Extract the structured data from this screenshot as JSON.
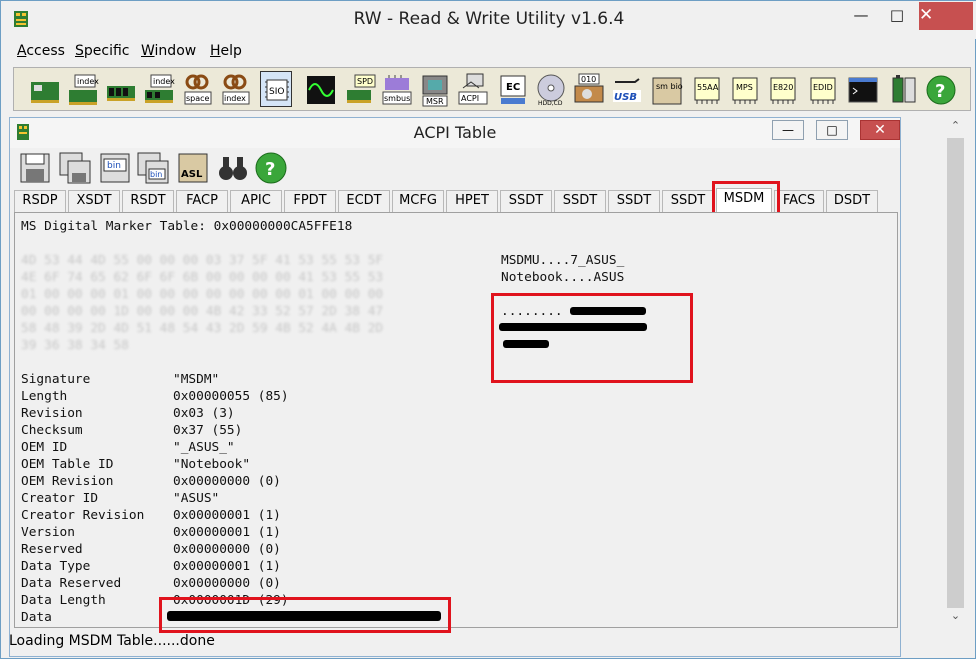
{
  "app": {
    "title": "RW - Read & Write Utility v1.6.4",
    "menu": [
      "Access",
      "Specific",
      "Window",
      "Help"
    ],
    "menu_underline": [
      "A",
      "S",
      "W",
      "H"
    ],
    "menu_rest": [
      "ccess",
      "pecific",
      "indow",
      "elp"
    ]
  },
  "toolbar": {
    "labels": [
      "index",
      "index",
      "space",
      "index",
      "SIO",
      "SPD",
      "smbus",
      "MSR",
      "ACPI",
      "EC",
      "HDD,CD",
      "010",
      "USB",
      "sm bios",
      "55AA",
      "MPS",
      "E820",
      "EDID"
    ]
  },
  "child": {
    "title": "ACPI Table",
    "toolbar_labels": [
      "bin",
      "bin",
      "ASL"
    ]
  },
  "tabs": [
    "RSDP",
    "XSDT",
    "RSDT",
    "FACP",
    "APIC",
    "FPDT",
    "ECDT",
    "MCFG",
    "HPET",
    "SSDT",
    "SSDT",
    "SSDT",
    "SSDT",
    "MSDM",
    "FACS",
    "DSDT"
  ],
  "selected_tab": "MSDM",
  "content": {
    "header": "MS Digital Marker Table: 0x00000000CA5FFE18",
    "ascii": [
      "MSDMU....7_ASUS_",
      "Notebook....ASUS",
      "........"
    ],
    "fields": [
      {
        "label": "Signature",
        "value": "\"MSDM\""
      },
      {
        "label": "Length",
        "value": "0x00000055 (85)"
      },
      {
        "label": "Revision",
        "value": "0x03 (3)"
      },
      {
        "label": "Checksum",
        "value": "0x37 (55)"
      },
      {
        "label": "OEM ID",
        "value": "\"_ASUS_\""
      },
      {
        "label": "OEM Table ID",
        "value": "\"Notebook\""
      },
      {
        "label": "OEM Revision",
        "value": "0x00000000 (0)"
      },
      {
        "label": "Creator ID",
        "value": "\"ASUS\""
      },
      {
        "label": "Creator Revision",
        "value": "0x00000001 (1)"
      },
      {
        "label": "Version",
        "value": "0x00000001 (1)"
      },
      {
        "label": "Reserved",
        "value": "0x00000000 (0)"
      },
      {
        "label": "Data Type",
        "value": "0x00000001 (1)"
      },
      {
        "label": "Data Reserved",
        "value": "0x00000000 (0)"
      },
      {
        "label": "Data Length",
        "value": "0x0000001D (29)"
      },
      {
        "label": "Data",
        "value": ""
      }
    ]
  },
  "status": "Loading MSDM Table......done",
  "colors": {
    "highlight": "#e0131d",
    "redaction": "#000000"
  }
}
